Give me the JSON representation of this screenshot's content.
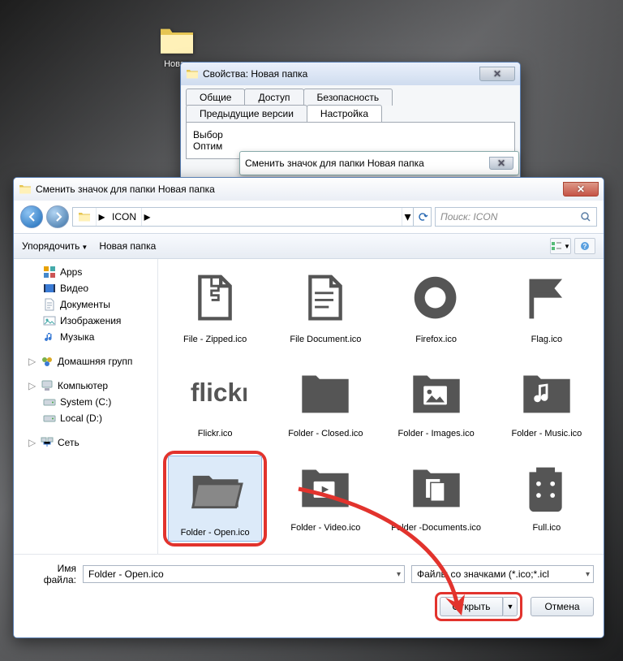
{
  "desktop": {
    "icon_label": "Новая"
  },
  "properties": {
    "title": "Свойства: Новая папка",
    "tabs": {
      "general": "Общие",
      "sharing": "Доступ",
      "security": "Безопасность",
      "prev": "Предыдущие версии",
      "customize": "Настройка"
    },
    "panel_line1": "Выбор",
    "panel_line2": "Оптим"
  },
  "mini": {
    "title": "Сменить значок для папки Новая папка"
  },
  "open": {
    "title": "Сменить значок для папки Новая папка",
    "path_segment": "ICON",
    "search_placeholder": "Поиск: ICON",
    "toolbar": {
      "organize": "Упорядочить",
      "newfolder": "Новая папка"
    },
    "tree": {
      "apps": "Apps",
      "video": "Видео",
      "documents": "Документы",
      "images": "Изображения",
      "music": "Музыка",
      "homegroup": "Домашняя групп",
      "computer": "Компьютер",
      "drive_c": "System (C:)",
      "drive_d": "Local (D:)",
      "network": "Сеть"
    },
    "items": [
      {
        "id": "file-zipped",
        "label": "File - Zipped.ico"
      },
      {
        "id": "file-document",
        "label": "File Document.ico"
      },
      {
        "id": "firefox",
        "label": "Firefox.ico"
      },
      {
        "id": "flag",
        "label": "Flag.ico"
      },
      {
        "id": "flickr",
        "label": "Flickr.ico"
      },
      {
        "id": "folder-closed",
        "label": "Folder - Closed.ico"
      },
      {
        "id": "folder-images",
        "label": "Folder - Images.ico"
      },
      {
        "id": "folder-music",
        "label": "Folder - Music.ico"
      },
      {
        "id": "folder-open",
        "label": "Folder - Open.ico",
        "selected": true,
        "highlighted": true
      },
      {
        "id": "folder-video",
        "label": "Folder - Video.ico"
      },
      {
        "id": "folder-documents",
        "label": "Folder -Documents.ico"
      },
      {
        "id": "full",
        "label": "Full.ico"
      }
    ],
    "filename_label": "Имя файла:",
    "filename_value": "Folder - Open.ico",
    "filter_value": "Файлы со значками (*.ico;*.icl",
    "open_btn": "Открыть",
    "cancel_btn": "Отмена"
  }
}
